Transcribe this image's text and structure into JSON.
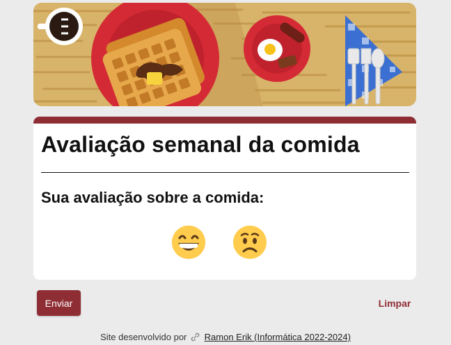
{
  "banner": {
    "description_icon": "breakfast-banner-image"
  },
  "form": {
    "title": "Avaliação semanal da comida",
    "question": "Sua avaliação sobre a comida:",
    "options": [
      {
        "icon": "grinning-face-icon"
      },
      {
        "icon": "frowning-face-icon"
      }
    ]
  },
  "actions": {
    "submit_label": "Enviar",
    "clear_label": "Limpar"
  },
  "footer": {
    "prefix": "Site desenvolvido por",
    "link_icon": "link-icon",
    "author_link": "Ramon Erik (Informática 2022-2024)"
  },
  "colors": {
    "accent": "#8f2d35",
    "background": "#ebebeb",
    "card": "#ffffff"
  }
}
